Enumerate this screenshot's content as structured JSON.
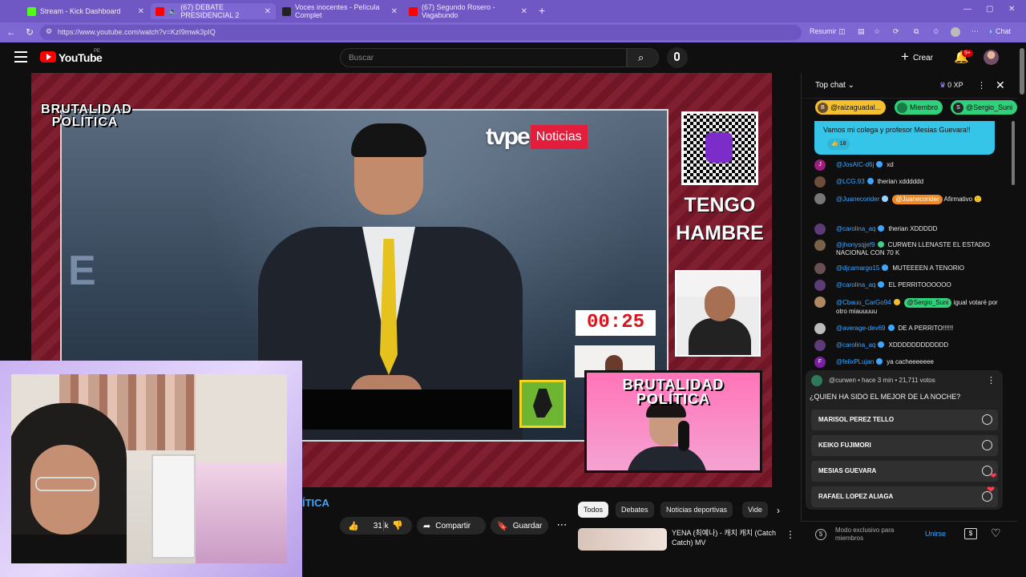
{
  "browser": {
    "tabs": [
      {
        "title": "Stream - Kick Dashboard",
        "favicon_color": "#53fc18"
      },
      {
        "title": "(67) DEBATE PRESIDENCIAL 2",
        "favicon_color": "#ff0000"
      },
      {
        "title": "Voces inocentes - Película Complet",
        "favicon_color": "#222222"
      },
      {
        "title": "(67) Segundo Rosero - Vagabundo",
        "favicon_color": "#ff0000"
      }
    ],
    "url": "https://www.youtube.com/watch?v=KzI9mwk3pIQ",
    "resume_label": "Resumir",
    "chat_label": "Chat"
  },
  "youtube": {
    "logo_text": "YouTube",
    "country_code": "PE",
    "search_placeholder": "Buscar",
    "create_label": "Crear",
    "notifications_count": "9+"
  },
  "video": {
    "channel_brand": "BRUTALIDAD\nPOLÍTICA",
    "broadcaster": "tvpe",
    "broadcaster_section": "Noticias",
    "overlay_text": "TENGO\nHAMBRE",
    "studio_letter": "E",
    "timer": "00:25",
    "stream_overlay_brand": "BRUTALIDAD\nPOLÍTICA"
  },
  "below_video": {
    "title_fragment": "ÍTICA",
    "likes": "31 k",
    "share_label": "Compartir",
    "save_label": "Guardar",
    "chips": [
      "Todos",
      "Debates",
      "Noticias deportivas",
      "Vide"
    ],
    "recommendation_title": "YENA (최예나) - 캐치 캐치 (Catch Catch) MV"
  },
  "chat": {
    "mode_label": "Top chat",
    "xp": "0 XP",
    "pinned_chips": [
      {
        "text": "@raizaguadal...",
        "color": "#f5c02e",
        "initial": "B"
      },
      {
        "text": "Miembro",
        "color": "#2fd27a",
        "initial": "M"
      },
      {
        "text": "@Sergio_Suni",
        "color": "#2fd27a",
        "initial": "S"
      }
    ],
    "pinned_message": "Vamos mi colega y profesor Mesias Guevara!!",
    "pinned_likes": "18",
    "messages": [
      {
        "user": "@JosAIC-d6j",
        "text": "xd",
        "avatar_color": "#9c1f7c",
        "initial": "J"
      },
      {
        "user": "@LCG.93",
        "text": "therian xdddddd",
        "avatar_color": "#6d4d3a",
        "initial": ""
      },
      {
        "user": "@Juanecorider",
        "mention": "@Juanecorider",
        "mention_color": "#f08a24",
        "text": "Afirmativo 🙂",
        "avatar_color": "#777777",
        "initial": ""
      },
      {
        "user": "@carolina_aq",
        "text": "therian XDDDDD",
        "avatar_color": "#5b3b78",
        "initial": ""
      },
      {
        "user": "@jhonysqjef9",
        "text": "CURWEN LLENASTE EL ESTADIO NACIONAL CON 70 K",
        "avatar_color": "#7a6248",
        "initial": ""
      },
      {
        "user": "@djcamargo15",
        "text": "MUTEEEEN A TENORIO",
        "avatar_color": "#6a4f52",
        "initial": ""
      },
      {
        "user": "@carolina_aq",
        "text": "EL PERRITOOOOOO",
        "avatar_color": "#5b3b78",
        "initial": ""
      },
      {
        "user": "@Cbauu_CarGo94",
        "mention": "@Sergio_Suni",
        "mention_color": "#2fd27a",
        "text": "igual votaré por otro miauuuuu",
        "avatar_color": "#b08860",
        "initial": ""
      },
      {
        "user": "@average-dev69",
        "text": "DE A PERRITO!!!!!!",
        "avatar_color": "#bcbcbc",
        "initial": ""
      },
      {
        "user": "@carolina_aq",
        "text": "XDDDDDDDDDDDD",
        "avatar_color": "#5b3b78",
        "initial": ""
      },
      {
        "user": "@felixPLujan",
        "text": "ya cacheeeeeee",
        "avatar_color": "#7b1fa2",
        "initial": "F"
      }
    ],
    "poll": {
      "meta": "@curwen • hace 3 min • 21,711 votos",
      "question": "¿QUIEN HA SIDO EL MEJOR DE LA NOCHE?",
      "options": [
        "MARISOL PEREZ TELLO",
        "KEIKO FUJIMORI",
        "MESIAS GUEVARA",
        "RAFAEL LOPEZ ALIAGA"
      ]
    },
    "footer": {
      "members_text": "Modo exclusivo para miembros",
      "join_label": "Unirse"
    }
  }
}
